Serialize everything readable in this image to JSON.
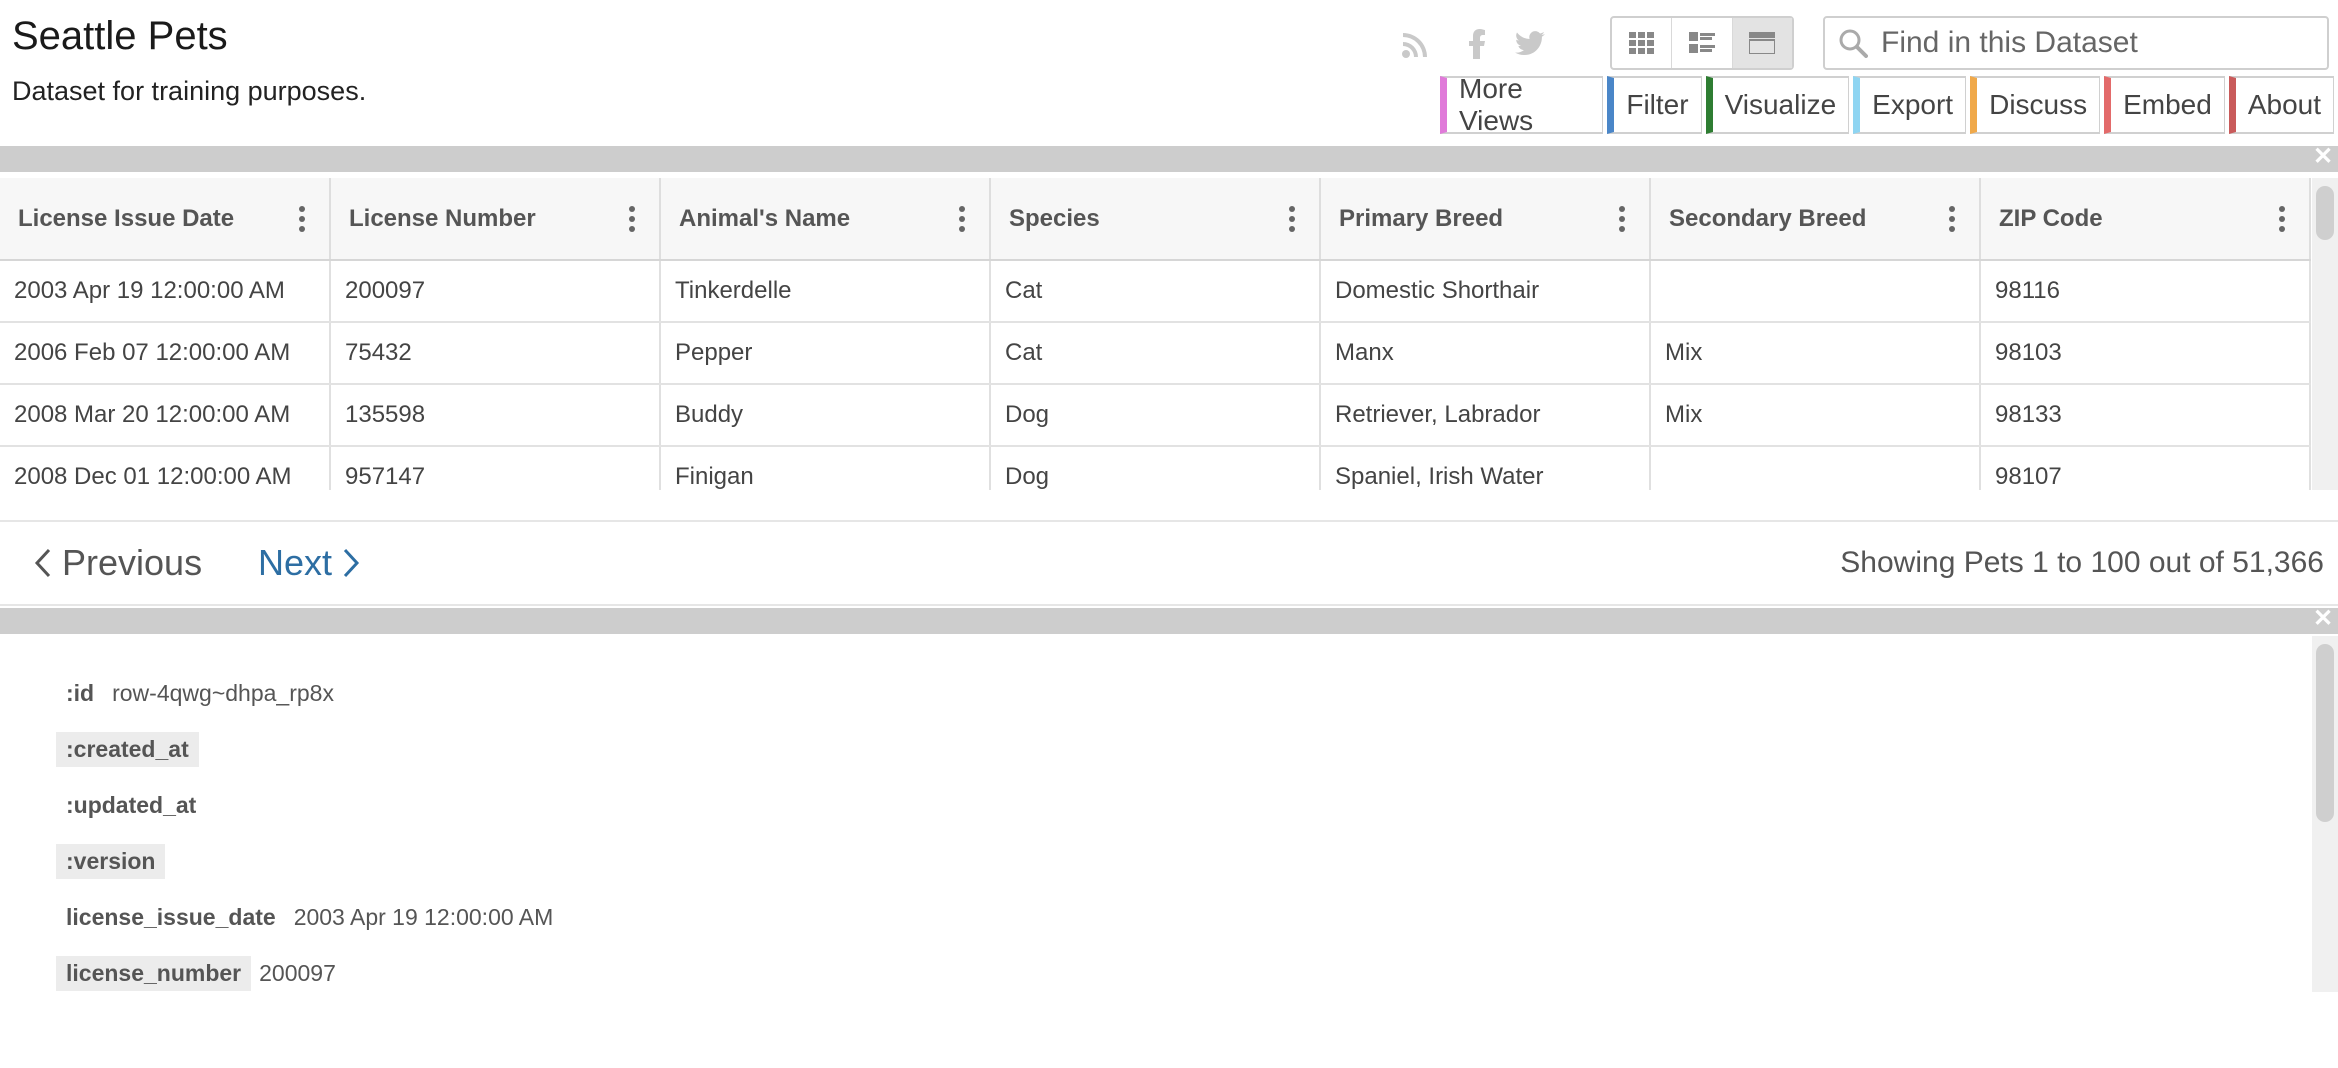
{
  "header": {
    "title": "Seattle Pets",
    "subtitle": "Dataset for training purposes."
  },
  "search": {
    "placeholder": "Find in this Dataset"
  },
  "social": [
    "rss-icon",
    "facebook-icon",
    "twitter-icon"
  ],
  "view_modes": [
    "grid-view-icon",
    "list-view-icon",
    "page-view-icon"
  ],
  "actions": [
    {
      "label": "More Views",
      "color": "#e07ad9"
    },
    {
      "label": "Filter",
      "color": "#4a86c8"
    },
    {
      "label": "Visualize",
      "color": "#2e7d32"
    },
    {
      "label": "Export",
      "color": "#8fd5f2"
    },
    {
      "label": "Discuss",
      "color": "#f0a94a"
    },
    {
      "label": "Embed",
      "color": "#e36a6a"
    },
    {
      "label": "About",
      "color": "#c95b5b"
    }
  ],
  "table": {
    "columns": [
      "License Issue Date",
      "License Number",
      "Animal's Name",
      "Species",
      "Primary Breed",
      "Secondary Breed",
      "ZIP Code"
    ],
    "rows": [
      [
        "2003 Apr 19 12:00:00 AM",
        "200097",
        "Tinkerdelle",
        "Cat",
        "Domestic Shorthair",
        "",
        "98116"
      ],
      [
        "2006 Feb 07 12:00:00 AM",
        "75432",
        "Pepper",
        "Cat",
        "Manx",
        "Mix",
        "98103"
      ],
      [
        "2008 Mar 20 12:00:00 AM",
        "135598",
        "Buddy",
        "Dog",
        "Retriever, Labrador",
        "Mix",
        "98133"
      ],
      [
        "2008 Dec 01 12:00:00 AM",
        "957147",
        "Finigan",
        "Dog",
        "Spaniel, Irish Water",
        "",
        "98107"
      ]
    ]
  },
  "pager": {
    "previous": "Previous",
    "next": "Next",
    "showing": "Showing Pets 1 to 100 out of 51,366"
  },
  "record": [
    {
      "key": ":id",
      "value": "row-4qwg~dhpa_rp8x"
    },
    {
      "key": ":created_at",
      "value": ""
    },
    {
      "key": ":updated_at",
      "value": ""
    },
    {
      "key": ":version",
      "value": ""
    },
    {
      "key": "license_issue_date",
      "value": "2003 Apr 19 12:00:00 AM"
    },
    {
      "key": "license_number",
      "value": "200097"
    }
  ]
}
